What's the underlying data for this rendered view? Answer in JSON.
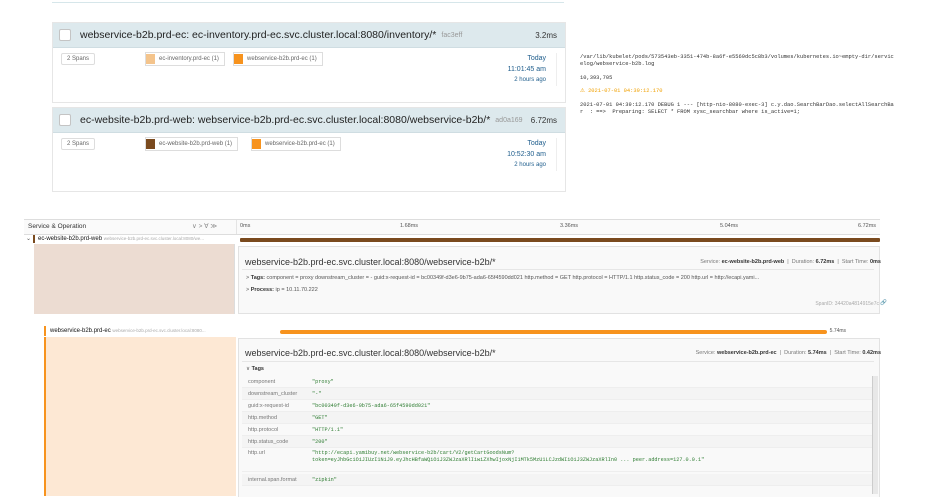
{
  "traces": [
    {
      "title": "webservice-b2b.prd-ec: ec-inventory.prd-ec.svc.cluster.local:8080/inventory/*",
      "trace_id": "fac3eff",
      "duration": "3.2ms",
      "spans": "2 Spans",
      "services": [
        {
          "label": "ec-inventory.prd-ec (1)",
          "color": "#f4c48c"
        },
        {
          "label": "webservice-b2b.prd-ec (1)",
          "color": "#f7931e"
        }
      ],
      "date": "Today",
      "time": "11:01:45 am",
      "ago": "2 hours ago"
    },
    {
      "title": "ec-website-b2b.prd-web: webservice-b2b.prd-ec.svc.cluster.local:8080/webservice-b2b/*",
      "trace_id": "ad0a169",
      "duration": "6.72ms",
      "spans": "2 Spans",
      "services": [
        {
          "label": "ec-website-b2b.prd-web (1)",
          "color": "#7a4a1e"
        },
        {
          "label": "webservice-b2b.prd-ec (1)",
          "color": "#f7931e"
        }
      ],
      "date": "Today",
      "time": "10:52:30 am",
      "ago": "2 hours ago"
    }
  ],
  "log": {
    "path1": "/var/lib/kubelet/pods/573543eb-3351-474b-8a6f-e5569dc5c8b3/volumes/kubernetes.io~empty-dir/servic",
    "path2": "elog/webservice-b2b.log",
    "line": "10,393,705",
    "warn": "⚠ 2021-07-01 04:39:12.170",
    "msg1": "2021-07-01 04:39:12.170 DEBUG 1 --- [http-nio-8080-exec-3] c.y.dao.SearchBarDao.selectAllSearchBa",
    "msg2": "r  : ==>  Preparing: SELECT * FROM xysc_searchbar where is_active=1;"
  },
  "timeline": {
    "header_label": "Service & Operation",
    "header_controls": "∨ > ∀ ≫",
    "ticks": [
      "0ms",
      "1.68ms",
      "3.36ms",
      "5.04ms",
      "6.72ms"
    ],
    "total_ms": 6.72,
    "span1": {
      "service": "ec-website-b2b.prd-web",
      "op": "webservice-b2b.prd-ec.svc.cluster.local:8080/we...",
      "start_ms": 0,
      "dur_ms": 6.72,
      "color": "#7a4a1e",
      "title": "webservice-b2b.prd-ec.svc.cluster.local:8080/webservice-b2b/*",
      "meta_service_label": "Service:",
      "meta_service": "ec-website-b2b.prd-web",
      "meta_duration_label": "Duration:",
      "meta_duration": "6.72ms",
      "meta_start_label": "Start Time:",
      "meta_start": "0ms",
      "tags_label": "Tags:",
      "tags_text": "component = proxy   downstream_cluster = -   guid:x-request-id = bc00349f-d3e6-9b75-ada6-65f4590dd021   http.method = GET   http.protocol = HTTP/1.1   http.status_code = 200   http.url = http://ecapi.yami...",
      "process_label": "Process:",
      "process_text": "ip = 10.11.70.222",
      "span_id": "SpanID: 34420a4814915e7c"
    },
    "span2": {
      "service": "webservice-b2b.prd-ec",
      "op": "webservice-b2b.prd-ec.svc.cluster.local:8080...",
      "start_ms": 0.42,
      "dur_ms": 5.74,
      "bar_label": "5.74ms",
      "color": "#f7931e",
      "title": "webservice-b2b.prd-ec.svc.cluster.local:8080/webservice-b2b/*",
      "meta_service_label": "Service:",
      "meta_service": "webservice-b2b.prd-ec",
      "meta_duration_label": "Duration:",
      "meta_duration": "5.74ms",
      "meta_start_label": "Start Time:",
      "meta_start": "0.42ms",
      "tags_label": "Tags",
      "tags": [
        {
          "k": "component",
          "v": "\"proxy\""
        },
        {
          "k": "downstream_cluster",
          "v": "\"-\""
        },
        {
          "k": "guid:x-request-id",
          "v": "\"bc00349f-d3e6-9b75-ada6-65f4590dd021\""
        },
        {
          "k": "http.method",
          "v": "\"GET\""
        },
        {
          "k": "http.protocol",
          "v": "\"HTTP/1.1\""
        },
        {
          "k": "http.status_code",
          "v": "\"200\""
        },
        {
          "k": "http.url",
          "v": "\"http://ecapi.yamibuy.net/webservice-b2b/cart/V2/getCartGoodsNum?"
        },
        {
          "k": "internal.span.format",
          "v": "\"zipkin\""
        }
      ],
      "url_line2": "token=eyJhbGciOiJIUzI1NiJ9.eyJhcHBfaWQiOiJ3ZWJzaXRlIiwiZXhwIjoxNjI1MTk5MzU1LCJzdWIiOiJ3ZWJzaXRlIn0 ... peer.address=127.0.0.1\""
    }
  }
}
